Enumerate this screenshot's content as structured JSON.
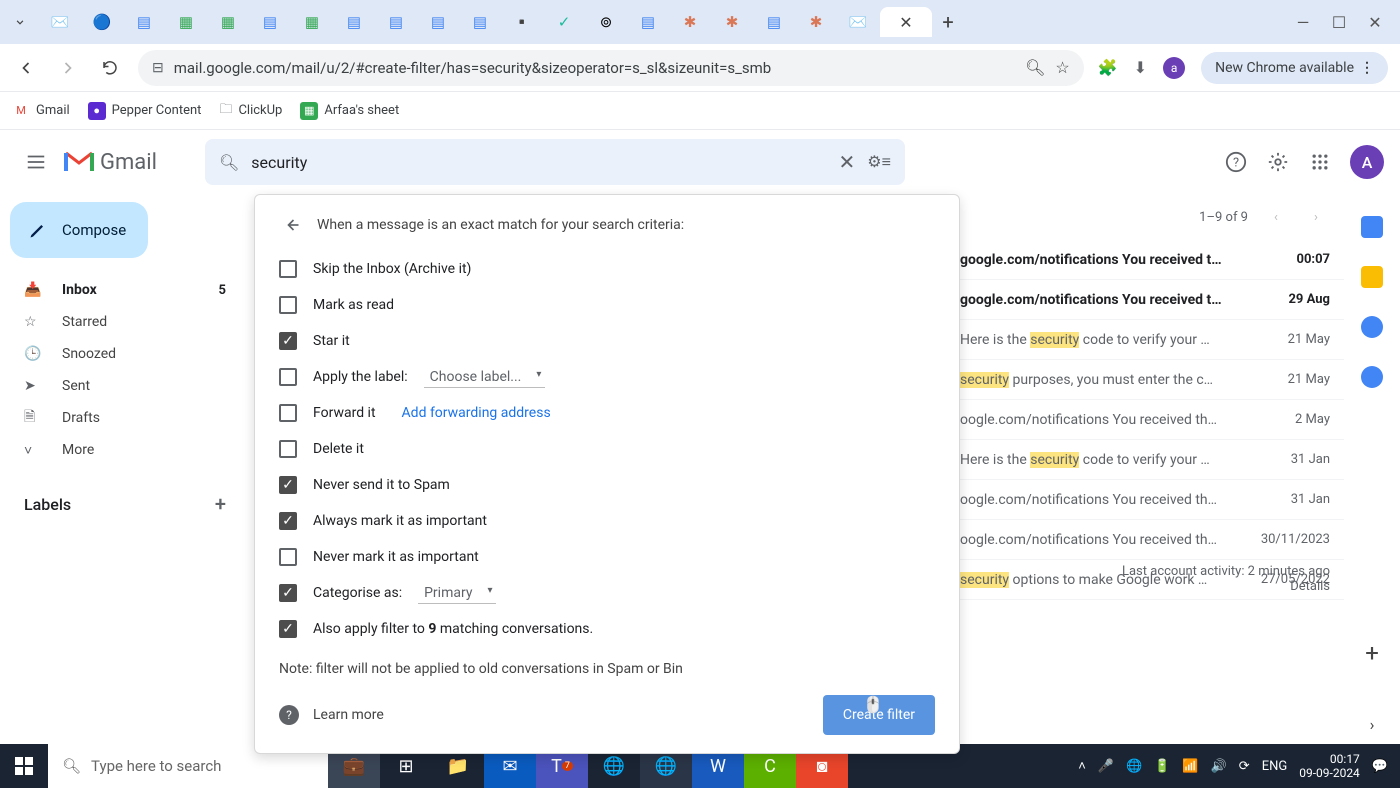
{
  "chrome": {
    "url": "mail.google.com/mail/u/2/#create-filter/has=security&sizeoperator=s_sl&sizeunit=s_smb",
    "update_label": "New Chrome available",
    "bookmarks": [
      {
        "label": "Gmail",
        "color": "#ea4335"
      },
      {
        "label": "Pepper Content",
        "color": "#5b2bd1"
      },
      {
        "label": "ClickUp",
        "color": "none"
      },
      {
        "label": "Arfaa's sheet",
        "color": "#34a853"
      }
    ]
  },
  "gmail": {
    "logo": "Gmail",
    "search_value": "security",
    "avatar": "A",
    "compose": "Compose",
    "nav": [
      {
        "icon": "inbox",
        "label": "Inbox",
        "count": "5",
        "active": true
      },
      {
        "icon": "star",
        "label": "Starred"
      },
      {
        "icon": "clock",
        "label": "Snoozed"
      },
      {
        "icon": "send",
        "label": "Sent"
      },
      {
        "icon": "draft",
        "label": "Drafts"
      },
      {
        "icon": "more",
        "label": "More"
      }
    ],
    "labels_header": "Labels",
    "pager": "1–9 of 9"
  },
  "filter": {
    "title": "When a message is an exact match for your search criteria:",
    "options": [
      {
        "checked": false,
        "label": "Skip the Inbox (Archive it)"
      },
      {
        "checked": false,
        "label": "Mark as read"
      },
      {
        "checked": true,
        "label": "Star it"
      },
      {
        "checked": false,
        "label": "Apply the label:",
        "select": "Choose label..."
      },
      {
        "checked": false,
        "label": "Forward it",
        "link": "Add forwarding address"
      },
      {
        "checked": false,
        "label": "Delete it"
      },
      {
        "checked": true,
        "label": "Never send it to Spam"
      },
      {
        "checked": true,
        "label": "Always mark it as important"
      },
      {
        "checked": false,
        "label": "Never mark it as important"
      },
      {
        "checked": true,
        "label": "Categorise as:",
        "select": "Primary"
      }
    ],
    "also_apply_pre": "Also apply filter to ",
    "also_apply_count": "9",
    "also_apply_post": " matching conversations.",
    "note": "Note: filter will not be applied to old conversations in Spam or Bin",
    "learn_more": "Learn more",
    "create": "Create filter"
  },
  "mails": [
    {
      "unread": true,
      "snippet": "google.com/notifications You received t…",
      "date": "00:07"
    },
    {
      "unread": true,
      "snippet": "google.com/notifications You received t…",
      "date": "29 Aug"
    },
    {
      "unread": false,
      "pre": "Here is the ",
      "hl": "security",
      "post": " code to verify your …",
      "date": "21 May"
    },
    {
      "unread": false,
      "hl": "security",
      "post": " purposes, you must enter the c…",
      "date": "21 May"
    },
    {
      "unread": false,
      "snippet": "oogle.com/notifications You received th…",
      "date": "2 May"
    },
    {
      "unread": false,
      "pre": "Here is the ",
      "hl": "security",
      "post": " code to verify your …",
      "date": "31 Jan"
    },
    {
      "unread": false,
      "snippet": "oogle.com/notifications You received th…",
      "date": "31 Jan"
    },
    {
      "unread": false,
      "snippet": "oogle.com/notifications You received th…",
      "date": "30/11/2023"
    },
    {
      "unread": false,
      "hl": "security",
      "post": " options to make Google work …",
      "date": "27/05/2022"
    }
  ],
  "activity": {
    "last": "Last account activity: 2 minutes ago",
    "details": "Details"
  },
  "taskbar": {
    "search_placeholder": "Type here to search",
    "lang": "ENG",
    "time": "00:17",
    "date": "09-09-2024"
  }
}
